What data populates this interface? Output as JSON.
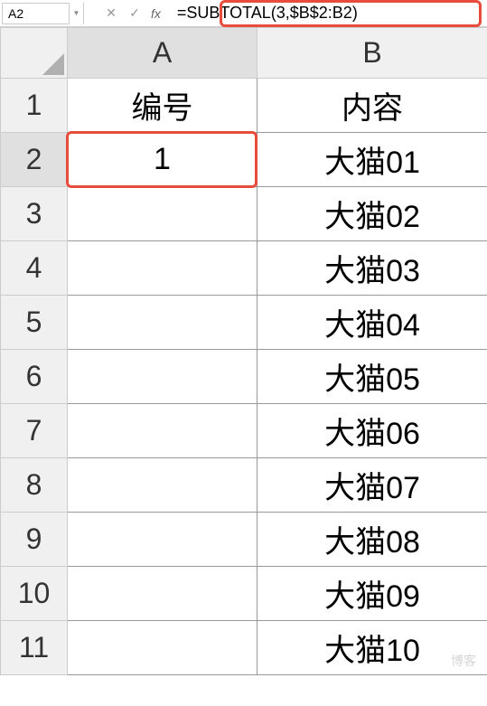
{
  "nameBox": {
    "value": "A2"
  },
  "formulaBar": {
    "formula": "=SUBTOTAL(3,$B$2:B2)"
  },
  "columns": {
    "A": "A",
    "B": "B"
  },
  "headers": {
    "A": "编号",
    "B": "内容"
  },
  "rows": [
    {
      "num": "1",
      "A": "编号",
      "B": "内容"
    },
    {
      "num": "2",
      "A": "1",
      "B": "大猫01"
    },
    {
      "num": "3",
      "A": "",
      "B": "大猫02"
    },
    {
      "num": "4",
      "A": "",
      "B": "大猫03"
    },
    {
      "num": "5",
      "A": "",
      "B": "大猫04"
    },
    {
      "num": "6",
      "A": "",
      "B": "大猫05"
    },
    {
      "num": "7",
      "A": "",
      "B": "大猫06"
    },
    {
      "num": "8",
      "A": "",
      "B": "大猫07"
    },
    {
      "num": "9",
      "A": "",
      "B": "大猫08"
    },
    {
      "num": "10",
      "A": "",
      "B": "大猫09"
    },
    {
      "num": "11",
      "A": "",
      "B": "大猫10"
    }
  ],
  "activeCell": "A2",
  "watermark": "博客"
}
